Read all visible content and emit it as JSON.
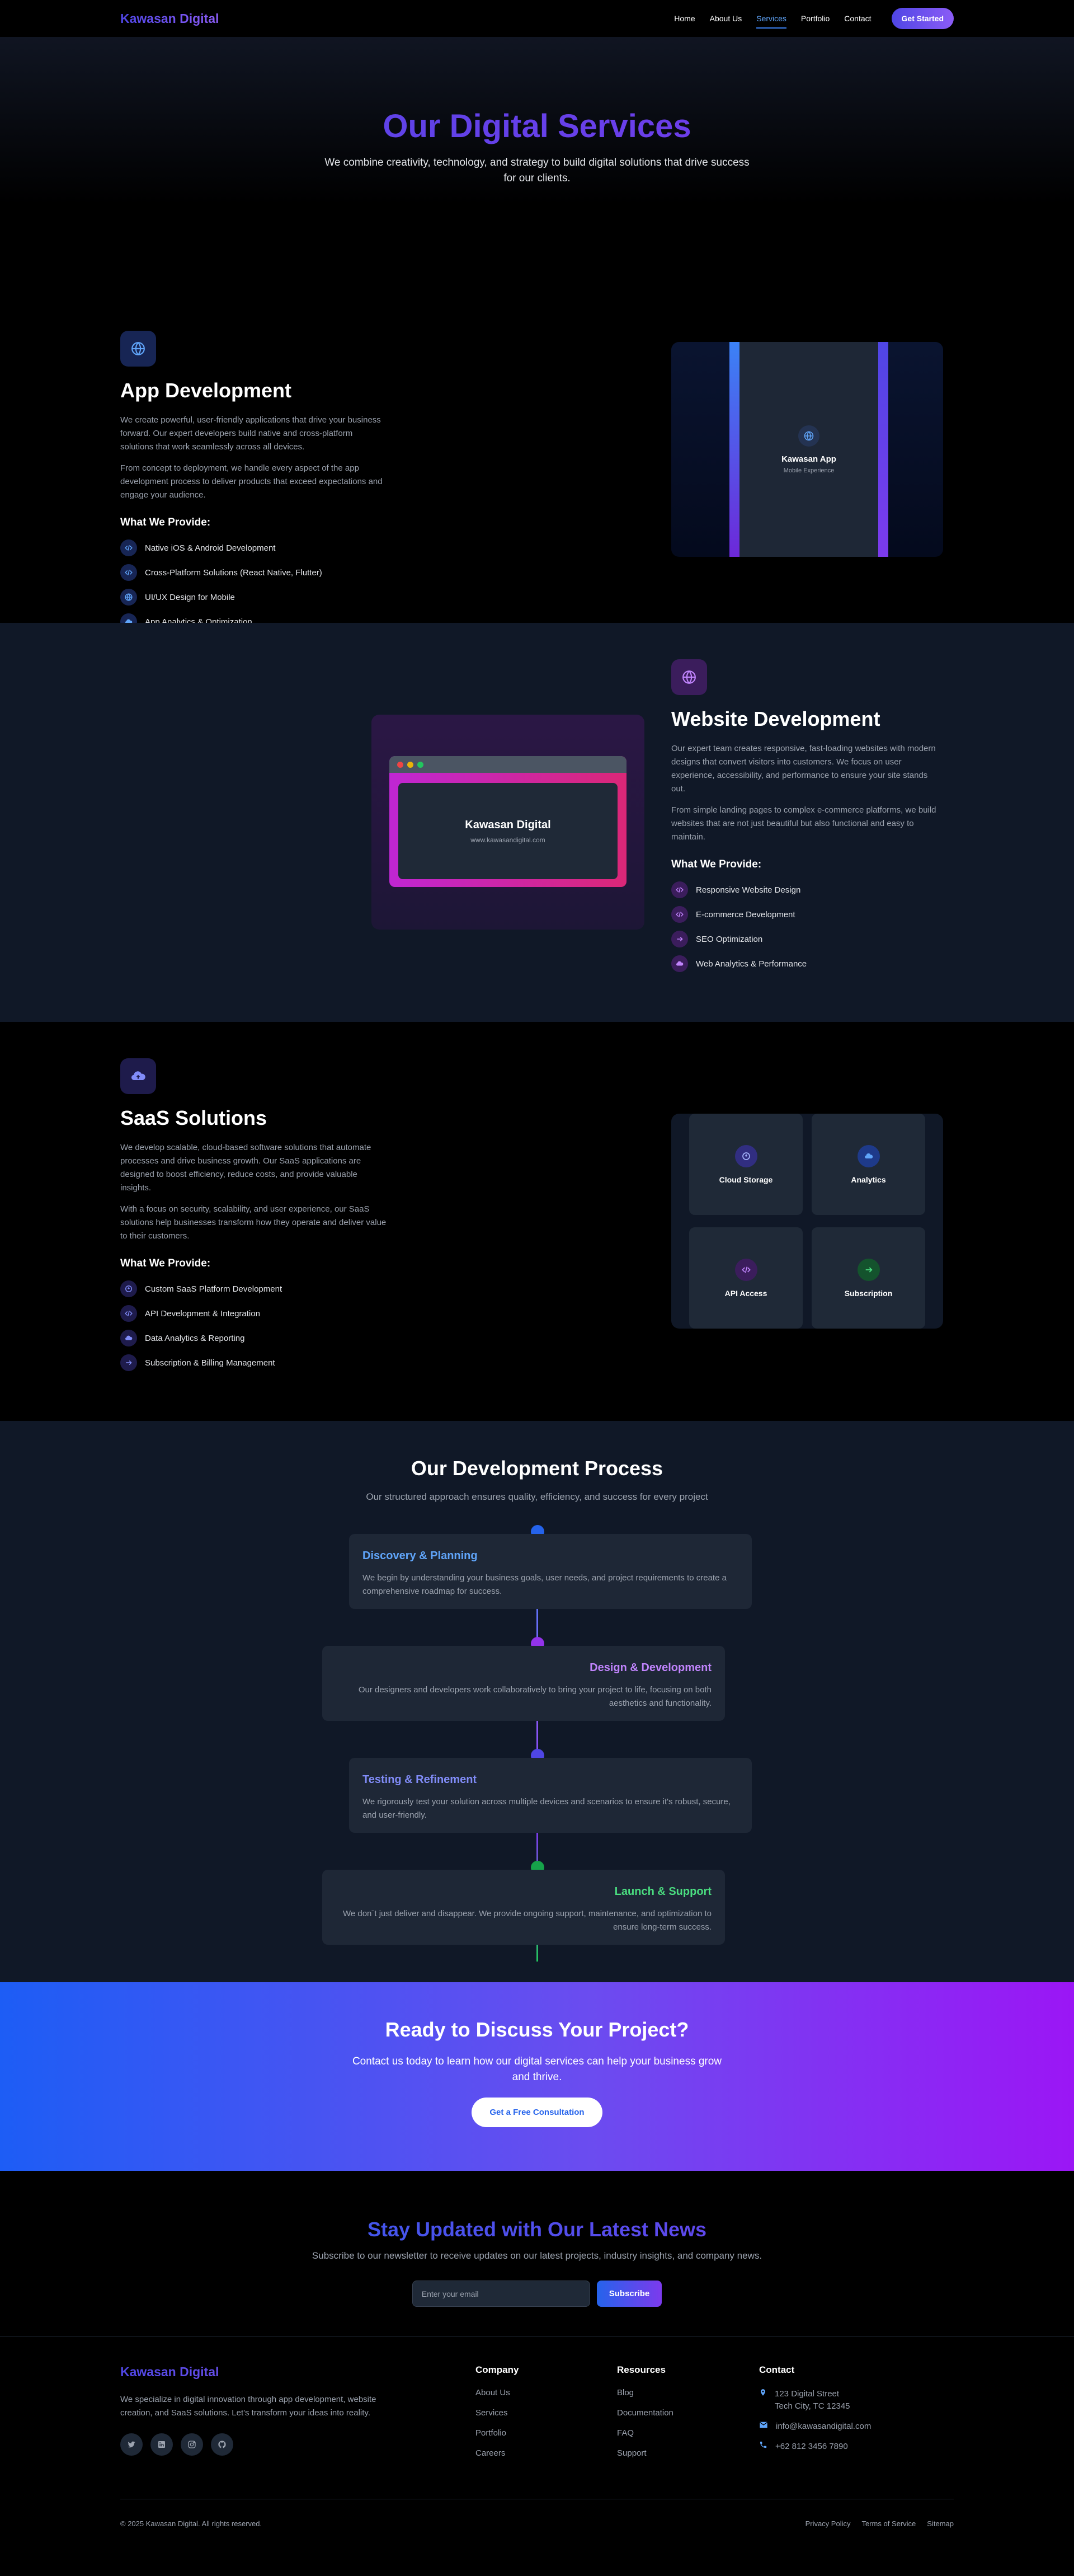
{
  "nav": {
    "logo": "Kawasan Digital",
    "links": [
      "Home",
      "About Us",
      "Services",
      "Portfolio",
      "Contact"
    ],
    "active": "Services",
    "cta": "Get Started"
  },
  "hero": {
    "title": "Our Digital Services",
    "subtitle": "We combine creativity, technology, and strategy to build digital solutions that drive success for our clients."
  },
  "app": {
    "title": "App Development",
    "desc1": "We create powerful, user-friendly applications that drive your business forward. Our expert developers build native and cross-platform solutions that work seamlessly across all devices.",
    "desc2": "From concept to deployment, we handle every aspect of the app development process to deliver products that exceed expectations and engage your audience.",
    "provide_heading": "What We Provide:",
    "features": [
      "Native iOS & Android Development",
      "Cross-Platform Solutions (React Native, Flutter)",
      "UI/UX Design for Mobile",
      "App Analytics & Optimization"
    ],
    "mock_title": "Kawasan App",
    "mock_sub": "Mobile Experience",
    "icon": "globe-icon"
  },
  "web": {
    "title": "Website Development",
    "desc1": "Our expert team creates responsive, fast-loading websites with modern designs that convert visitors into customers. We focus on user experience, accessibility, and performance to ensure your site stands out.",
    "desc2": "From simple landing pages to complex e-commerce platforms, we build websites that are not just beautiful but also functional and easy to maintain.",
    "provide_heading": "What We Provide:",
    "features": [
      "Responsive Website Design",
      "E-commerce Development",
      "SEO Optimization",
      "Web Analytics & Performance"
    ],
    "mock_title": "Kawasan Digital",
    "mock_url": "www.kawasandigital.com",
    "icon": "globe-icon"
  },
  "saas": {
    "title": "SaaS Solutions",
    "desc1": "We develop scalable, cloud-based software solutions that automate processes and drive business growth. Our SaaS applications are designed to boost efficiency, reduce costs, and provide valuable insights.",
    "desc2": "With a focus on security, scalability, and user experience, our SaaS solutions help businesses transform how they operate and deliver value to their customers.",
    "provide_heading": "What We Provide:",
    "features": [
      "Custom SaaS Platform Development",
      "API Development & Integration",
      "Data Analytics & Reporting",
      "Subscription & Billing Management"
    ],
    "tiles": [
      "Cloud Storage",
      "Analytics",
      "API Access",
      "Subscription"
    ],
    "icon": "cloud-upload-icon"
  },
  "process": {
    "title": "Our Development Process",
    "subtitle": "Our structured approach ensures quality, efficiency, and success for every project",
    "steps": [
      {
        "title": "Discovery & Planning",
        "text": "We begin by understanding your business goals, user needs, and project requirements to create a comprehensive roadmap for success."
      },
      {
        "title": "Design & Development",
        "text": "Our designers and developers work collaboratively to bring your project to life, focusing on both aesthetics and functionality."
      },
      {
        "title": "Testing & Refinement",
        "text": "We rigorously test your solution across multiple devices and scenarios to ensure it's robust, secure, and user-friendly."
      },
      {
        "title": "Launch & Support",
        "text": "We don¨t just deliver and disappear. We provide ongoing support, maintenance, and optimization to ensure long-term success."
      }
    ]
  },
  "cta": {
    "title": "Ready to Discuss Your Project?",
    "text": "Contact us today to learn how our digital services can help your business grow and thrive.",
    "button": "Get a Free Consultation"
  },
  "newsletter": {
    "title": "Stay Updated with Our Latest News",
    "text": "Subscribe to our newsletter to receive updates on our latest projects, industry insights, and company news.",
    "placeholder": "Enter your email",
    "button": "Subscribe"
  },
  "footer": {
    "logo": "Kawasan Digital",
    "about": "We specialize in digital innovation through app development, website creation, and SaaS solutions. Let's transform your ideas into reality.",
    "socials": [
      "twitter-icon",
      "linkedin-icon",
      "instagram-icon",
      "github-icon"
    ],
    "company": {
      "heading": "Company",
      "links": [
        "About Us",
        "Services",
        "Portfolio",
        "Careers"
      ]
    },
    "resources": {
      "heading": "Resources",
      "links": [
        "Blog",
        "Documentation",
        "FAQ",
        "Support"
      ]
    },
    "contact": {
      "heading": "Contact",
      "address1": "123 Digital Street",
      "address2": "Tech City, TC 12345",
      "email": "info@kawasandigital.com",
      "phone": "+62 812 3456 7890"
    },
    "copyright": "© 2025 Kawasan Digital. All rights reserved.",
    "bottom_links": [
      "Privacy Policy",
      "Terms of Service",
      "Sitemap"
    ]
  }
}
